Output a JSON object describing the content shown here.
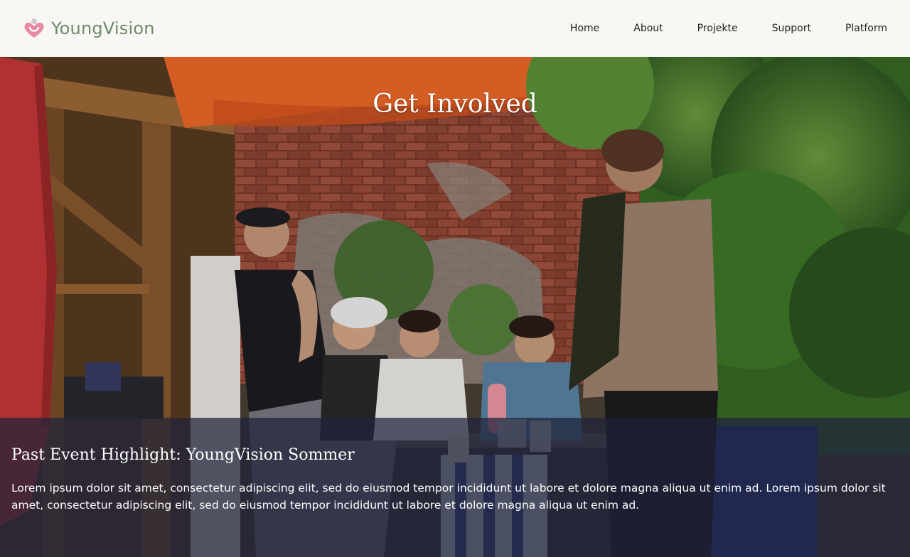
{
  "brand": {
    "name": "YoungVision",
    "logo_icon": "heart-person-icon",
    "color": "#6f8a6a",
    "accent": "#e98aa3"
  },
  "nav": {
    "items": [
      "Home",
      "About",
      "Projekte",
      "Support",
      "Platform"
    ]
  },
  "hero": {
    "title": "Get Involved"
  },
  "event": {
    "heading": "Past Event Highlight: YoungVision Sommer",
    "text": "Lorem ipsum dolor sit amet, consectetur adipiscing elit, sed do eiusmod tempor incididunt ut labore et dolore magna aliqua ut enim ad. Lorem ipsum dolor sit amet, consectetur adipiscing elit, sed do eiusmod tempor incididunt ut labore et dolore magna aliqua ut enim ad."
  }
}
